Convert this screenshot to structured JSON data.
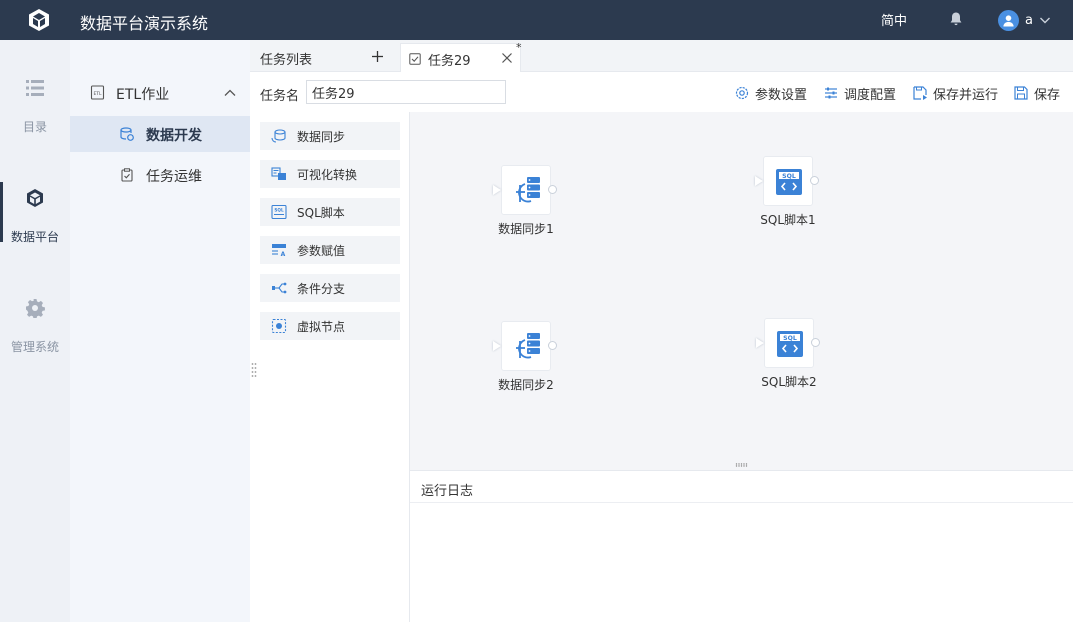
{
  "app": {
    "title": "数据平台演示系统",
    "language": "简中",
    "user_name": "a"
  },
  "rail": {
    "items": [
      {
        "label": "目录",
        "icon": "list-icon",
        "active": false
      },
      {
        "label": "数据平台",
        "icon": "cube-icon",
        "active": true
      },
      {
        "label": "管理系统",
        "icon": "gear-icon",
        "active": false
      }
    ]
  },
  "nav": {
    "group": {
      "label": "ETL作业",
      "expanded": true
    },
    "items": [
      {
        "label": "数据开发",
        "active": true
      },
      {
        "label": "任务运维",
        "active": false
      }
    ]
  },
  "tabs": {
    "list_label": "任务列表",
    "active_tab": {
      "label": "任务29",
      "modified_mark": "*"
    }
  },
  "toolbar": {
    "name_label": "任务名",
    "name_value": "任务29",
    "buttons": [
      {
        "label": "参数设置",
        "icon": "settings-icon"
      },
      {
        "label": "调度配置",
        "icon": "sliders-icon"
      },
      {
        "label": "保存并运行",
        "icon": "save-run-icon"
      },
      {
        "label": "保存",
        "icon": "save-icon"
      }
    ]
  },
  "palette": {
    "items": [
      {
        "label": "数据同步",
        "icon": "data-sync-icon"
      },
      {
        "label": "可视化转换",
        "icon": "visual-transform-icon"
      },
      {
        "label": "SQL脚本",
        "icon": "sql-icon"
      },
      {
        "label": "参数赋值",
        "icon": "param-assign-icon"
      },
      {
        "label": "条件分支",
        "icon": "branch-icon"
      },
      {
        "label": "虚拟节点",
        "icon": "virtual-node-icon"
      }
    ]
  },
  "canvas": {
    "nodes": [
      {
        "label": "数据同步1",
        "type": "data-sync"
      },
      {
        "label": "SQL脚本1",
        "type": "sql"
      },
      {
        "label": "数据同步2",
        "type": "data-sync"
      },
      {
        "label": "SQL脚本2",
        "type": "sql"
      }
    ]
  },
  "log": {
    "title": "运行日志"
  },
  "colors": {
    "topbar": "#2c3a4f",
    "accent": "#3b82d6",
    "canvas_bg": "#f4f5f8"
  }
}
